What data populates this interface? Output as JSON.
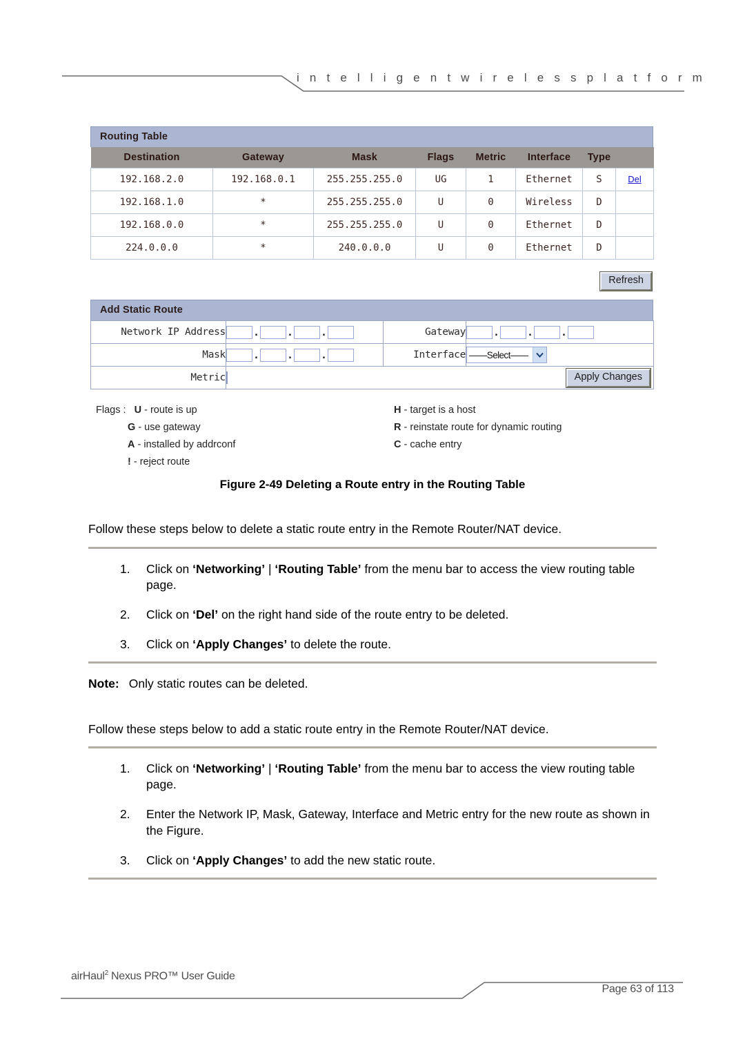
{
  "header": {
    "tagline": "i n t e l l i g e n t    w i r e l e s s    p l a t f o r m"
  },
  "routing_table": {
    "panel_title": "Routing Table",
    "columns": [
      "Destination",
      "Gateway",
      "Mask",
      "Flags",
      "Metric",
      "Interface",
      "Type",
      ""
    ],
    "rows": [
      {
        "destination": "192.168.2.0",
        "gateway": "192.168.0.1",
        "mask": "255.255.255.0",
        "flags": "UG",
        "metric": "1",
        "interface": "Ethernet",
        "type": "S",
        "action": "Del"
      },
      {
        "destination": "192.168.1.0",
        "gateway": "*",
        "mask": "255.255.255.0",
        "flags": "U",
        "metric": "0",
        "interface": "Wireless",
        "type": "D",
        "action": ""
      },
      {
        "destination": "192.168.0.0",
        "gateway": "*",
        "mask": "255.255.255.0",
        "flags": "U",
        "metric": "0",
        "interface": "Ethernet",
        "type": "D",
        "action": ""
      },
      {
        "destination": "224.0.0.0",
        "gateway": "*",
        "mask": "240.0.0.0",
        "flags": "U",
        "metric": "0",
        "interface": "Ethernet",
        "type": "D",
        "action": ""
      }
    ],
    "refresh_label": "Refresh"
  },
  "add_static_route": {
    "panel_title": "Add Static Route",
    "labels": {
      "network_ip": "Network IP Address",
      "mask": "Mask",
      "metric": "Metric",
      "gateway": "Gateway",
      "interface": "Interface"
    },
    "values": {
      "network_ip_octets": [
        "",
        "",
        "",
        ""
      ],
      "mask_octets": [
        "",
        "",
        "",
        ""
      ],
      "gateway_octets": [
        "",
        "",
        "",
        ""
      ],
      "metric": "",
      "interface_selected": "——Select——"
    },
    "apply_label": "Apply Changes",
    "octet_separator": "."
  },
  "flags_legend": {
    "title": "Flags :",
    "left": [
      {
        "key": "U",
        "desc": "- route is up"
      },
      {
        "key": "G",
        "desc": "- use gateway"
      },
      {
        "key": "A",
        "desc": "- installed by addrconf"
      },
      {
        "key": "!",
        "desc": "- reject route"
      }
    ],
    "right": [
      {
        "key": "H",
        "desc": "- target is a host"
      },
      {
        "key": "R",
        "desc": "- reinstate route for dynamic routing"
      },
      {
        "key": "C",
        "desc": "- cache entry"
      }
    ]
  },
  "figure": {
    "caption": "Figure 2-49 Deleting a Route entry in the Routing Table"
  },
  "body": {
    "delete_intro": "Follow these steps below to delete a static route entry in the Remote Router/NAT device.",
    "delete_steps": [
      {
        "pre": "Click on ",
        "b1": "‘Networking’",
        "mid1": " | ",
        "b2": "‘Routing Table’",
        "post": " from the menu bar to access the view routing table page."
      },
      {
        "pre": "Click on ",
        "b1": "‘Del’",
        "mid1": "",
        "b2": "",
        "post": " on the right hand side of the route entry to be deleted."
      },
      {
        "pre": "Click on ",
        "b1": "‘Apply Changes’",
        "mid1": "",
        "b2": "",
        "post": " to delete the route."
      }
    ],
    "note_label": "Note:",
    "note_text": "Only static routes can be deleted.",
    "add_intro": "Follow these steps below to add a static route entry in the Remote Router/NAT device.",
    "add_steps": [
      {
        "pre": "Click on ",
        "b1": "‘Networking’",
        "mid1": " | ",
        "b2": "‘Routing Table’",
        "post": " from the menu bar to access the view routing table page."
      },
      {
        "pre": "Enter the Network IP, Mask, Gateway, Interface and Metric entry for the new route as shown in the Figure.",
        "b1": "",
        "mid1": "",
        "b2": "",
        "post": ""
      },
      {
        "pre": "Click on ",
        "b1": "‘Apply Changes’",
        "mid1": "",
        "b2": "",
        "post": " to add the new static route."
      }
    ]
  },
  "footer": {
    "guide_prefix": "airHaul",
    "guide_sup": "2",
    "guide_suffix": " Nexus PRO™ User Guide",
    "page_label": "Page 63 of 113"
  }
}
